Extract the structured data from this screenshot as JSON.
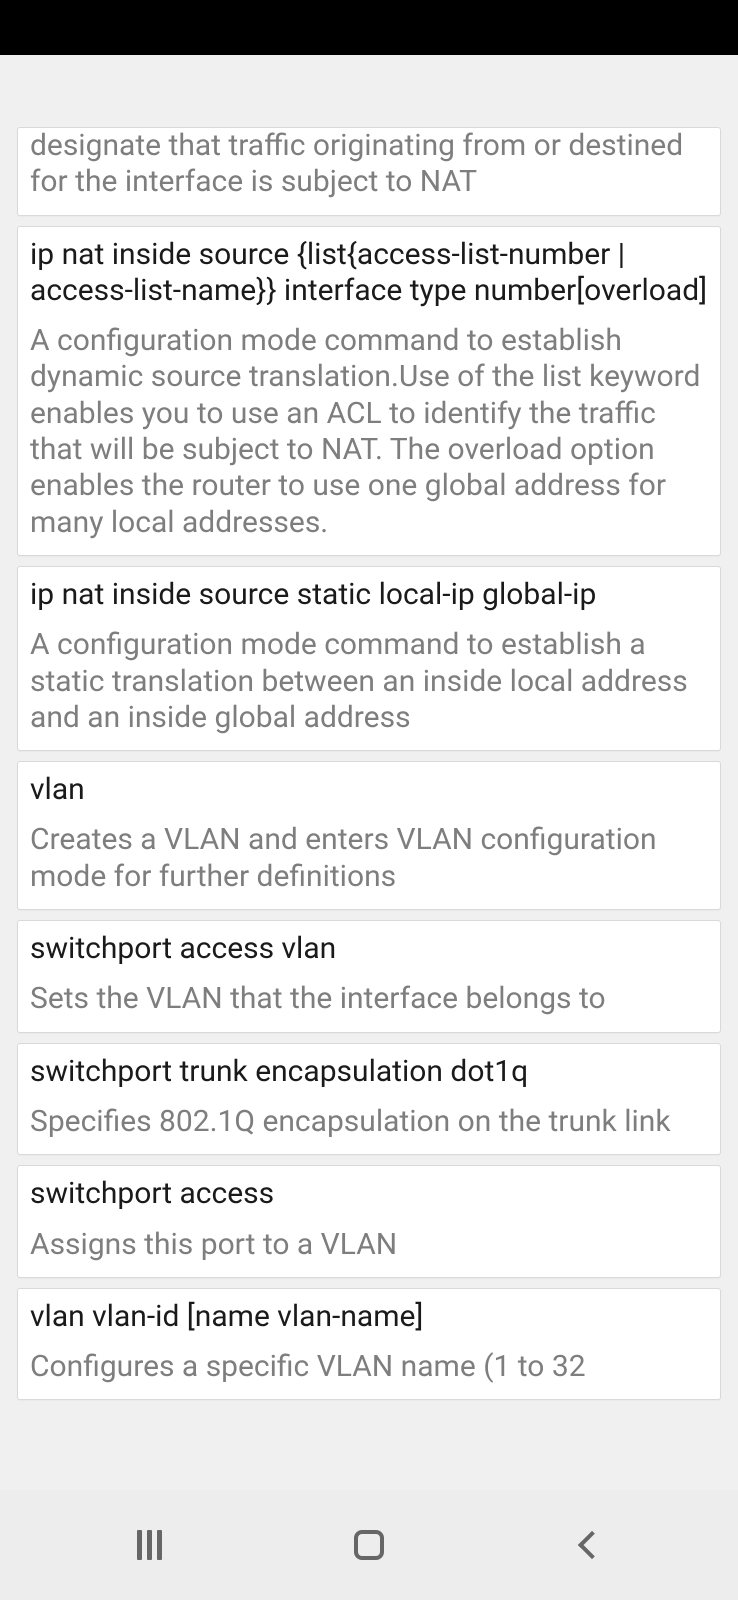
{
  "cards": [
    {
      "title": "",
      "desc": "designate that traffic originating from or destined for the interface is subject to NAT"
    },
    {
      "title": "ip nat inside source {list{access-list-number | access-list-name}} interface type number[overload]",
      "desc": "A configuration mode command to establish dynamic source translation.Use of the list keyword enables you to use an ACL to identify the traffic that will be subject to NAT. The overload option enables the router to use one global address for many local addresses."
    },
    {
      "title": "ip nat inside source static local-ip global-ip",
      "desc": "A configuration mode command to establish a static translation between an inside local address and an inside global address"
    },
    {
      "title": "vlan",
      "desc": "Creates a VLAN and enters VLAN configuration mode for further definitions"
    },
    {
      "title": "switchport access vlan",
      "desc": "Sets the VLAN that the interface belongs to"
    },
    {
      "title": "switchport trunk encapsulation dot1q",
      "desc": "Specifies 802.1Q encapsulation on the trunk link"
    },
    {
      "title": "switchport access",
      "desc": "Assigns this port to a VLAN"
    },
    {
      "title": "vlan vlan-id [name vlan-name]",
      "desc": "Configures a specific VLAN name (1 to 32"
    }
  ],
  "nav": {
    "recents": "recents",
    "home": "home",
    "back": "back"
  }
}
